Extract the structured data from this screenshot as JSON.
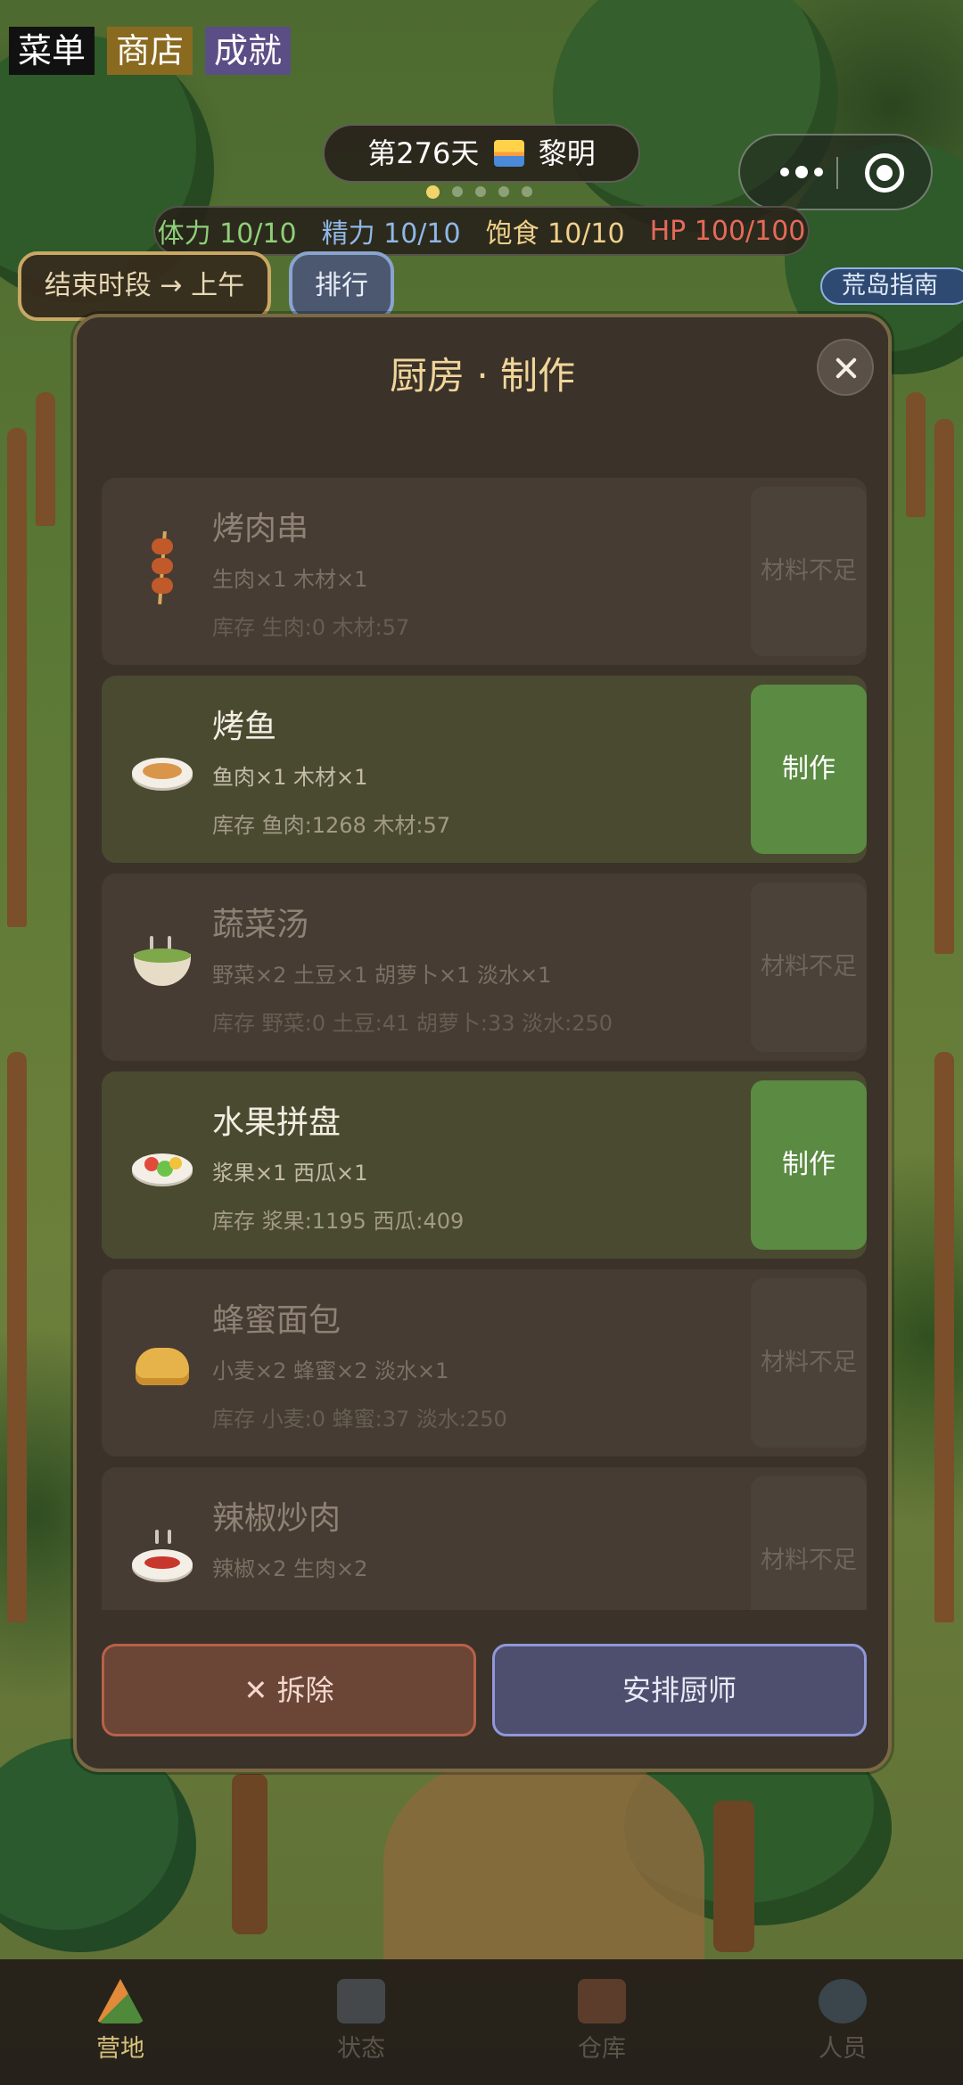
{
  "top_buttons": {
    "menu": "菜单",
    "shop": "商店",
    "achievements": "成就"
  },
  "day": {
    "label": "第276天",
    "phase": "黎明"
  },
  "stats": {
    "stamina": "体力 10/10",
    "energy": "精力 10/10",
    "satiety": "饱食 10/10",
    "hp": "HP 100/100"
  },
  "colors": {
    "stamina": "#8fcf7a",
    "energy": "#8fb8e8",
    "satiety": "#f0d08a",
    "hp": "#e56a5a",
    "make_button": "#5b8a43"
  },
  "actions": {
    "end_phase": "结束时段 → 上午",
    "ranking": "排行",
    "guide": "荒岛指南"
  },
  "modal": {
    "title": "厨房 · 制作",
    "recipes": [
      {
        "name": "烤肉串",
        "materials": "生肉×1  木材×1",
        "stock": "库存 生肉:0  木材:57",
        "action": "材料不足",
        "available": false,
        "icon": "skewer-icon"
      },
      {
        "name": "烤鱼",
        "materials": "鱼肉×1  木材×1",
        "stock": "库存 鱼肉:1268  木材:57",
        "action": "制作",
        "available": true,
        "icon": "grilled-fish-icon"
      },
      {
        "name": "蔬菜汤",
        "materials": "野菜×2  土豆×1  胡萝卜×1  淡水×1",
        "stock": "库存 野菜:0  土豆:41  胡萝卜:33  淡水:250",
        "action": "材料不足",
        "available": false,
        "icon": "soup-bowl-icon"
      },
      {
        "name": "水果拼盘",
        "materials": "浆果×1  西瓜×1",
        "stock": "库存 浆果:1195  西瓜:409",
        "action": "制作",
        "available": true,
        "icon": "fruit-platter-icon"
      },
      {
        "name": "蜂蜜面包",
        "materials": "小麦×2  蜂蜜×2  淡水×1",
        "stock": "库存 小麦:0  蜂蜜:37  淡水:250",
        "action": "材料不足",
        "available": false,
        "icon": "honey-bread-icon"
      },
      {
        "name": "辣椒炒肉",
        "materials": "辣椒×2  生肉×2",
        "stock": "",
        "action": "材料不足",
        "available": false,
        "icon": "chili-pork-icon"
      }
    ],
    "remove_label": "✕ 拆除",
    "assign_chef_label": "安排厨师"
  },
  "nav": [
    {
      "label": "营地",
      "icon": "camp-icon",
      "active": true
    },
    {
      "label": "状态",
      "icon": "chart-icon",
      "active": false
    },
    {
      "label": "仓库",
      "icon": "box-icon",
      "active": false
    },
    {
      "label": "人员",
      "icon": "people-icon",
      "active": false
    }
  ]
}
